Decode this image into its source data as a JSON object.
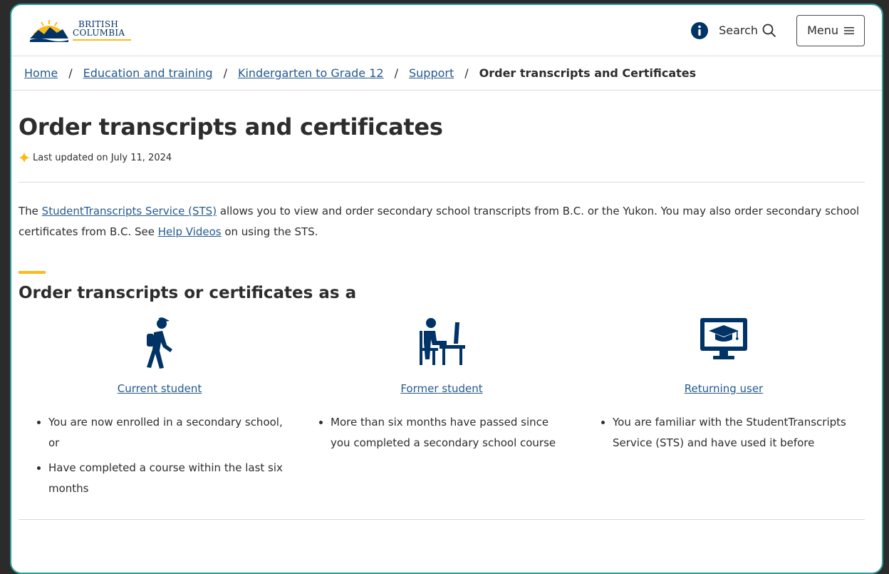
{
  "header": {
    "logo_line1": "BRITISH",
    "logo_line2": "COLUMBIA",
    "search_label": "Search",
    "menu_label": "Menu",
    "icons": {
      "info": "info-icon",
      "search": "search-icon",
      "menu": "hamburger-icon"
    }
  },
  "breadcrumb": {
    "items": [
      "Home",
      "Education and training",
      "Kindergarten to Grade 12",
      "Support"
    ],
    "current": "Order transcripts and Certificates",
    "separator": "/"
  },
  "page": {
    "title": "Order transcripts and certificates",
    "updated": "Last updated on July 11, 2024",
    "intro": {
      "before_link1": "The ",
      "link1": "StudentTranscripts Service (STS)",
      "after_link1": " allows you to view and order secondary school transcripts from B.C. or the Yukon. You may also order secondary school certificates from B.C. See ",
      "link2": "Help Videos",
      "after_link2": " on using the STS."
    },
    "section_title": "Order transcripts or certificates as a"
  },
  "cards": [
    {
      "icon": "walking-student-icon",
      "link": "Current student",
      "bullets": [
        "You are now enrolled in a secondary school, or",
        "Have completed a course within the last six months"
      ]
    },
    {
      "icon": "student-at-desk-icon",
      "link": "Former student",
      "bullets": [
        "More than six months have passed since you completed a secondary school course"
      ]
    },
    {
      "icon": "graduation-monitor-icon",
      "link": "Returning user",
      "bullets": [
        "You are familiar with the StudentTranscripts Service (STS) and have used it before"
      ]
    }
  ],
  "colors": {
    "brand_blue": "#013366",
    "link": "#255a90",
    "gold": "#fcba19",
    "frame": "#2e9d9a"
  }
}
